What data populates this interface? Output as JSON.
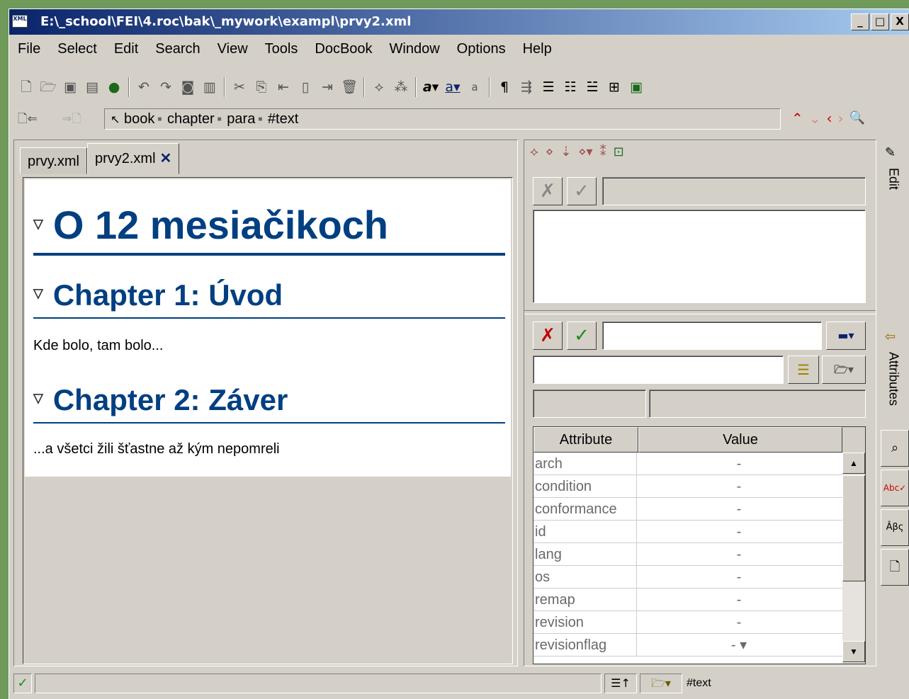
{
  "window": {
    "title": "E:\\_school\\FEI\\4.roc\\bak\\_mywork\\exampl\\prvy2.xml",
    "app_icon_text": "XML",
    "controls": {
      "minimize": "_",
      "maximize": "□",
      "close": "X"
    }
  },
  "menu": [
    "File",
    "Select",
    "Edit",
    "Search",
    "View",
    "Tools",
    "DocBook",
    "Window",
    "Options",
    "Help"
  ],
  "breadcrumb": {
    "items": [
      "book",
      "chapter",
      "para",
      "#text"
    ]
  },
  "tabs": [
    {
      "label": "prvy.xml",
      "active": false
    },
    {
      "label": "prvy2.xml",
      "active": true,
      "close": "✕"
    }
  ],
  "document": {
    "h1": "O 12 mesiačikoch",
    "chapters": [
      {
        "title": "Chapter 1: Úvod",
        "para": "Kde bolo, tam bolo..."
      },
      {
        "title": "Chapter 2: Záver",
        "para": "...a všetci žili šťastne až kým nepomreli"
      }
    ]
  },
  "attributes_table": {
    "headers": [
      "Attribute",
      "Value"
    ],
    "rows": [
      {
        "name": "arch",
        "value": "-"
      },
      {
        "name": "condition",
        "value": "-"
      },
      {
        "name": "conformance",
        "value": "-"
      },
      {
        "name": "id",
        "value": "-"
      },
      {
        "name": "lang",
        "value": "-"
      },
      {
        "name": "os",
        "value": "-"
      },
      {
        "name": "remap",
        "value": "-"
      },
      {
        "name": "revision",
        "value": "-"
      },
      {
        "name": "revisionflag",
        "value": "- ▾"
      }
    ]
  },
  "side_tabs": {
    "edit": "Edit",
    "attributes": "Attributes"
  },
  "status": {
    "element": "#text"
  },
  "colors": {
    "heading": "#003f80",
    "title_gradient_start": "#0a246a",
    "reject": "#c00000",
    "accept": "#1a8a1a"
  }
}
